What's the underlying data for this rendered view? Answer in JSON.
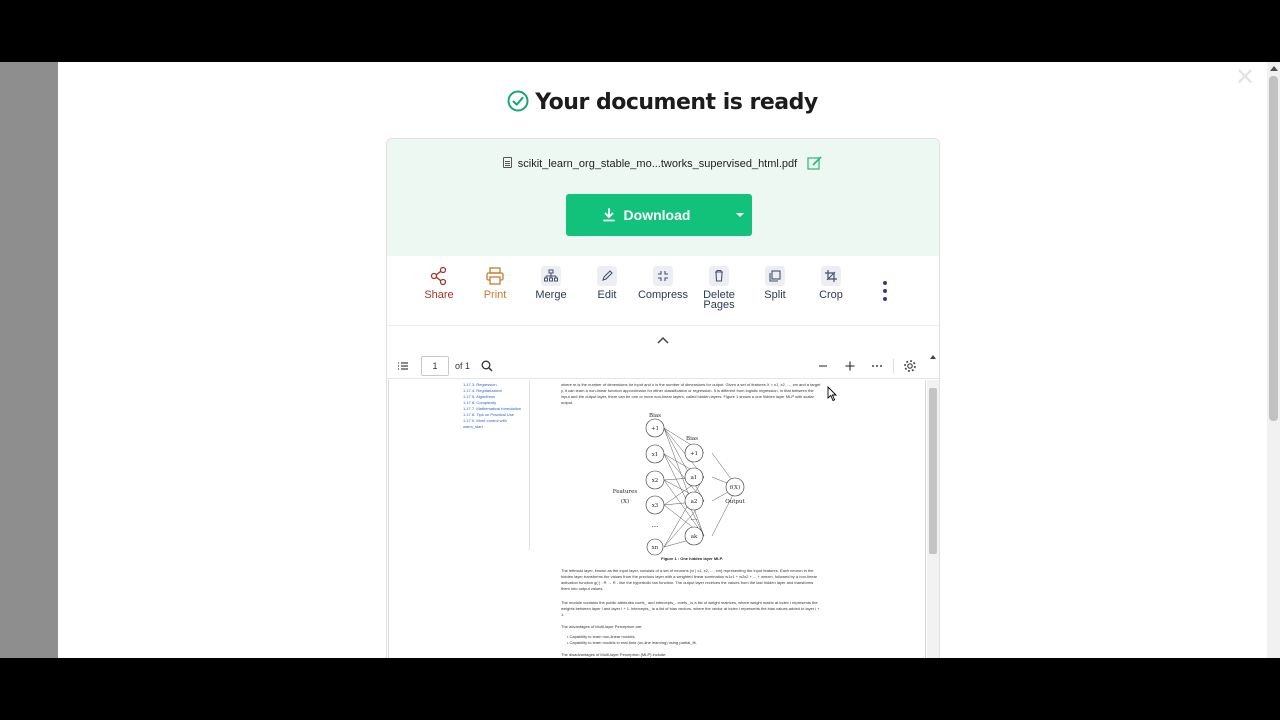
{
  "title": "Your document is ready",
  "file": {
    "name": "scikit_learn_org_stable_mo...tworks_supervised_html.pdf"
  },
  "download": {
    "label": "Download"
  },
  "tools": [
    {
      "label": "Share",
      "color": "#a3342f",
      "icon": "share-icon"
    },
    {
      "label": "Print",
      "color": "#c87a2d",
      "icon": "printer-icon"
    },
    {
      "label": "Merge",
      "color": "#2b3a55",
      "icon": "merge-icon"
    },
    {
      "label": "Edit",
      "color": "#2b3a55",
      "icon": "pencil-icon"
    },
    {
      "label": "Compress",
      "color": "#2b3a55",
      "icon": "compress-icon"
    },
    {
      "label": "Delete Pages",
      "color": "#2b3a55",
      "icon": "trash-icon"
    },
    {
      "label": "Split",
      "color": "#2b3a55",
      "icon": "split-icon"
    },
    {
      "label": "Crop",
      "color": "#2b3a55",
      "icon": "crop-icon"
    }
  ],
  "viewer": {
    "page": "1",
    "of": "of 1"
  },
  "doc": {
    "toc": [
      "1.17.3. Regression",
      "1.17.4. Regularization",
      "1.17.5. Algorithms",
      "1.17.6. Complexity",
      "1.17.7. Mathematical formulation",
      "1.17.8. Tips on Practical Use",
      "1.17.9. More control with",
      "warm_start"
    ],
    "intro": "where m is the number of dimensions for input and o is the number of dimensions for output. Given a set of features X = x1, x2, ..., xm and a target y, it can learn a non-linear function approximator for either classification or regression. It is different from logistic regression, in that between the input and the output layer, there can be one or more non-linear layers, called hidden layers. Figure 1 shows a one hidden layer MLP with scalar output.",
    "figure": {
      "bias_top": "Bias",
      "bias_hidden": "Bias",
      "features": "Features",
      "features_x": "(X)",
      "output": "Output",
      "fx": "f(X)",
      "inputs": [
        "+1",
        "x1",
        "x2",
        "x3",
        "xn"
      ],
      "hidden": [
        "+1",
        "a1",
        "a2",
        "ak"
      ],
      "caption": "Figure 1 : One hidden layer MLP."
    },
    "p1": "The leftmost layer, known as the input layer, consists of a set of neurons {xi | x1, x2, ..., xm} representing the input features. Each neuron in the hidden layer transforms the values from the previous layer with a weighted linear summation w1x1 + w2x2 + ... + wmxm, followed by a non-linear activation function g(·) : R → R - like the hyperbolic tan function. The output layer receives the values from the last hidden layer and transforms them into output values.",
    "p2": "The module contains the public attributes coefs_ and intercepts_. coefs_ is a list of weight matrices, where weight matrix at index i represents the weights between layer i and layer i + 1. intercepts_ is a list of bias vectors, where the vector at index i represents the bias values added to layer i + 1.",
    "p3": "The advantages of Multi-layer Perceptron are:",
    "b1": "Capability to learn non-linear models.",
    "b2": "Capability to learn models in real-time (on-line learning) using partial_fit.",
    "p4": "The disadvantages of Multi-layer Perceptron (MLP) include:"
  },
  "colors": {
    "accent": "#13c27a",
    "check": "#17a673",
    "head_bg": "#eef8f3"
  }
}
